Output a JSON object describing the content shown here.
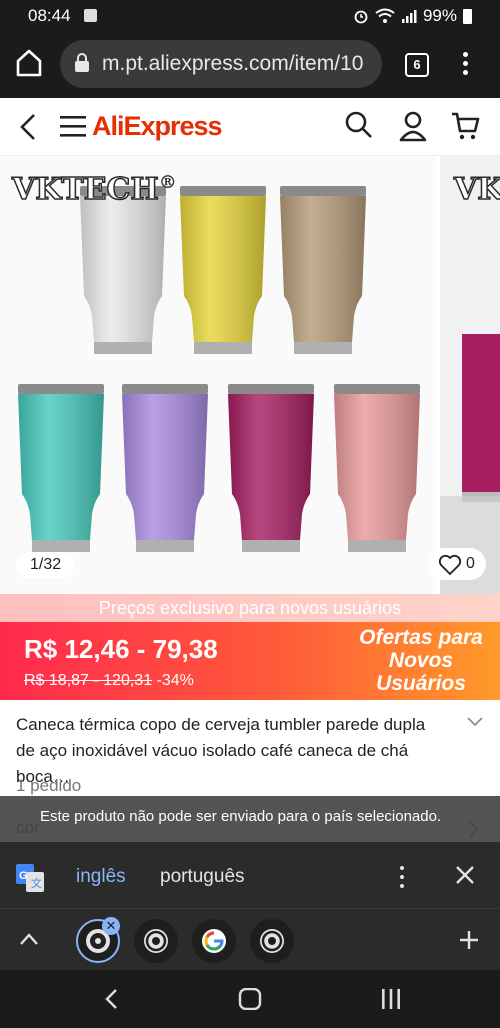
{
  "status_bar": {
    "time": "08:44",
    "battery": "99%"
  },
  "browser": {
    "url": "m.pt.aliexpress.com/item/10",
    "tab_count": "6"
  },
  "site": {
    "logo": "AliExpress"
  },
  "gallery": {
    "brand": "VKTECH",
    "brand_mark": "®",
    "counter": "1/32",
    "wishlist_count": "0",
    "tumbler_colors": [
      "#e9e9e9",
      "#e6d53a",
      "#b59c7a",
      "#46c9bb",
      "#a98be0",
      "#a61f62",
      "#e99a9b"
    ]
  },
  "promo": {
    "strip": "Preços exclusivo para novos usuários",
    "price": "R$ 12,46 - 79,38",
    "old_price": "R$ 18,87 - 120,31",
    "discount": "-34%",
    "offer_line1": "Ofertas para",
    "offer_line2": "Novos",
    "offer_line3": "Usuários"
  },
  "product": {
    "title": "Caneca térmica copo de cerveja tumbler parede dupla de aço inoxidável vácuo isolado café caneca de chá boca…",
    "orders": "1 pedido",
    "under_text": "cor"
  },
  "toast": {
    "message": "Este produto não pode ser enviado para o país selecionado."
  },
  "translate": {
    "lang_active": "inglês",
    "lang_other": "português"
  }
}
